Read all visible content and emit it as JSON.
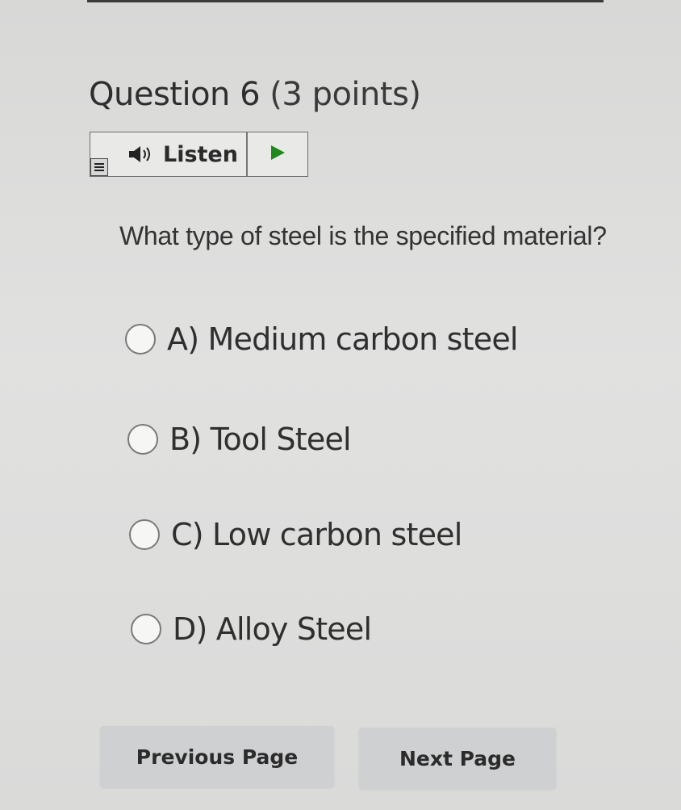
{
  "question": {
    "title": "Question 6",
    "points": "(3 points)",
    "text": "What type of steel is the specified material?"
  },
  "listen": {
    "menu_icon": "menu-icon",
    "speaker_icon": "speaker-icon",
    "label": "Listen",
    "play_icon": "play-icon",
    "play_color": "#1e8a1e"
  },
  "options": [
    {
      "label": "A) Medium carbon steel",
      "selected": false
    },
    {
      "label": "B) Tool Steel",
      "selected": false
    },
    {
      "label": "C) Low carbon steel",
      "selected": false
    },
    {
      "label": "D) Alloy Steel",
      "selected": false
    }
  ],
  "navigation": {
    "previous_label": "Previous Page",
    "next_label": "Next Page"
  }
}
